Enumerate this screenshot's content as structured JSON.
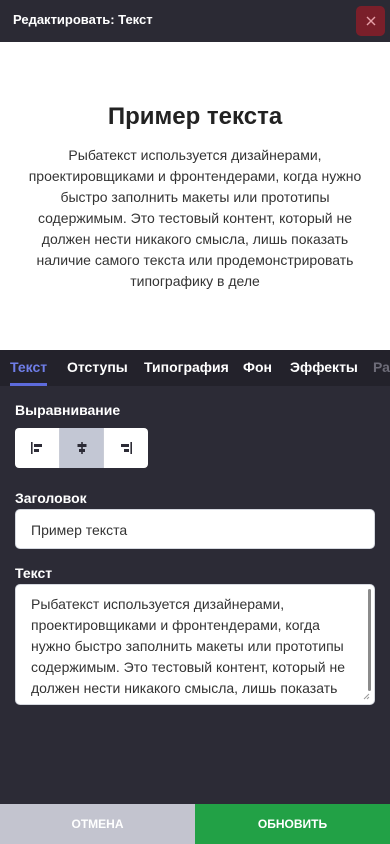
{
  "header": {
    "title": "Редактировать: Текст",
    "close_icon": "close-icon"
  },
  "preview": {
    "title": "Пример текста",
    "text": "Рыбатекст используется дизайнерами, проектировщиками и фронтендерами, когда нужно быстро заполнить макеты или прототипы содержимым. Это тестовый контент, который не должен нести никакого смысла, лишь показать наличие самого текста или продемонстрировать типографику в деле"
  },
  "tabs": [
    {
      "label": "Текст",
      "active": true
    },
    {
      "label": "Отступы"
    },
    {
      "label": "Типография"
    },
    {
      "label": "Фон"
    },
    {
      "label": "Эффекты"
    },
    {
      "label": "Ра"
    }
  ],
  "form": {
    "alignment_label": "Выравнивание",
    "alignment_options": [
      "align-left-icon",
      "align-center-icon",
      "align-right-icon"
    ],
    "alignment_selected": "center",
    "heading_label": "Заголовок",
    "heading_value": "Пример текста",
    "text_label": "Текст",
    "text_value": "Рыбатекст используется дизайнерами, проектировщиками и фронтендерами, когда нужно быстро заполнить макеты или прототипы содержимым. Это тестовый контент, который не должен нести никакого смысла, лишь показать наличие самого текста или продемонстрировать типографику в деле"
  },
  "footer": {
    "cancel_label": "ОТМЕНА",
    "update_label": "ОБНОВИТЬ"
  },
  "colors": {
    "accent": "#5d6bdc",
    "update": "#22a146",
    "cancel": "#c3c4cf",
    "close": "#7a1f2a",
    "panel": "#2c2b36"
  }
}
